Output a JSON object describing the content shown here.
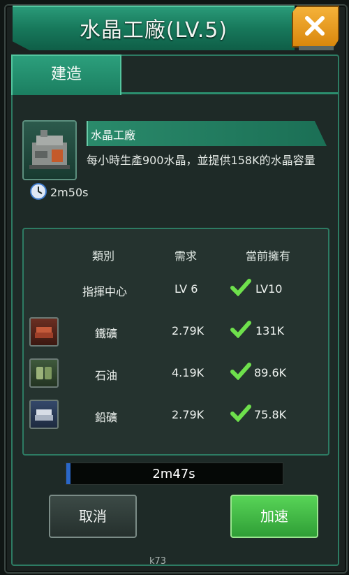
{
  "window": {
    "title": "水晶工廠(LV.5)",
    "close_icon": "close-icon"
  },
  "tabs": [
    {
      "label": "建造"
    }
  ],
  "building": {
    "name": "水晶工廠",
    "description": "每小時生產900水晶，並提供158K的水晶容量",
    "build_time": "2m50s"
  },
  "requirements": {
    "headers": [
      "類別",
      "需求",
      "當前擁有"
    ],
    "rows": [
      {
        "icon": "",
        "category": "指揮中心",
        "need": "LV 6",
        "have": "LV10"
      },
      {
        "icon": "iron-ore-icon",
        "category": "鐵礦",
        "need": "2.79K",
        "have": "131K"
      },
      {
        "icon": "oil-icon",
        "category": "石油",
        "need": "4.19K",
        "have": "89.6K"
      },
      {
        "icon": "lead-ore-icon",
        "category": "鉛礦",
        "need": "2.79K",
        "have": "75.8K"
      }
    ]
  },
  "progress": {
    "label": "2m47s",
    "fraction": 0.02,
    "color": "#2a67c8"
  },
  "buttons": {
    "cancel": "取消",
    "speed_up": "加速"
  },
  "watermark": "k73"
}
